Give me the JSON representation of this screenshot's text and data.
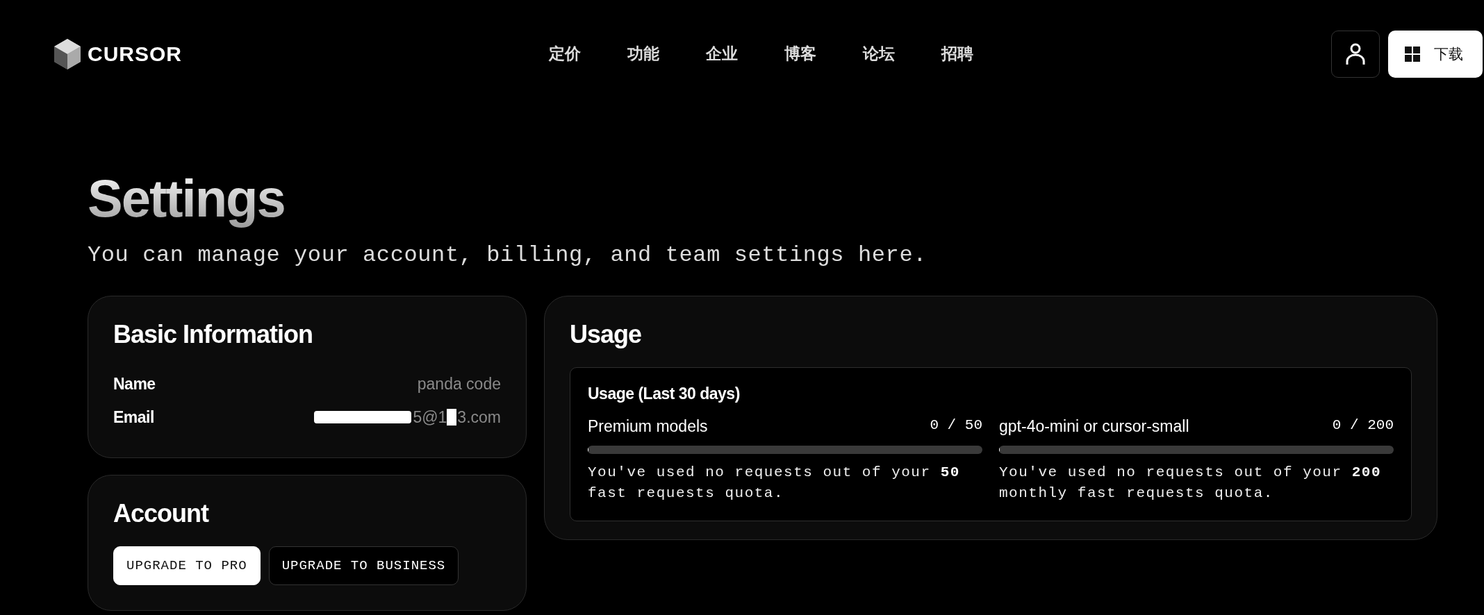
{
  "header": {
    "logo": "CURSOR",
    "nav": [
      "定价",
      "功能",
      "企业",
      "博客",
      "论坛",
      "招聘"
    ],
    "download": "下载"
  },
  "page": {
    "title": "Settings",
    "subtitle": "You can manage your account, billing, and team settings here."
  },
  "basic_info": {
    "title": "Basic Information",
    "fields": [
      {
        "label": "Name",
        "value": "panda code",
        "redacted": false
      },
      {
        "label": "Email",
        "value": "5@1",
        "value_end": "3.com",
        "redacted": true
      }
    ]
  },
  "account": {
    "title": "Account",
    "buttons": [
      {
        "label": "UPGRADE TO PRO",
        "primary": true
      },
      {
        "label": "UPGRADE TO BUSINESS",
        "primary": false
      }
    ]
  },
  "usage": {
    "title": "Usage",
    "box_title": "Usage (Last 30 days)",
    "meters": [
      {
        "name": "Premium models",
        "reading": "0 / 50",
        "level": 0,
        "note": "You've used no requests out of your **50** fast requests quota."
      },
      {
        "name": "gpt-4o-mini or cursor-small",
        "reading": "0 / 200",
        "level": 0,
        "note": "You've used no requests out of your **200** monthly fast requests quota."
      }
    ]
  }
}
